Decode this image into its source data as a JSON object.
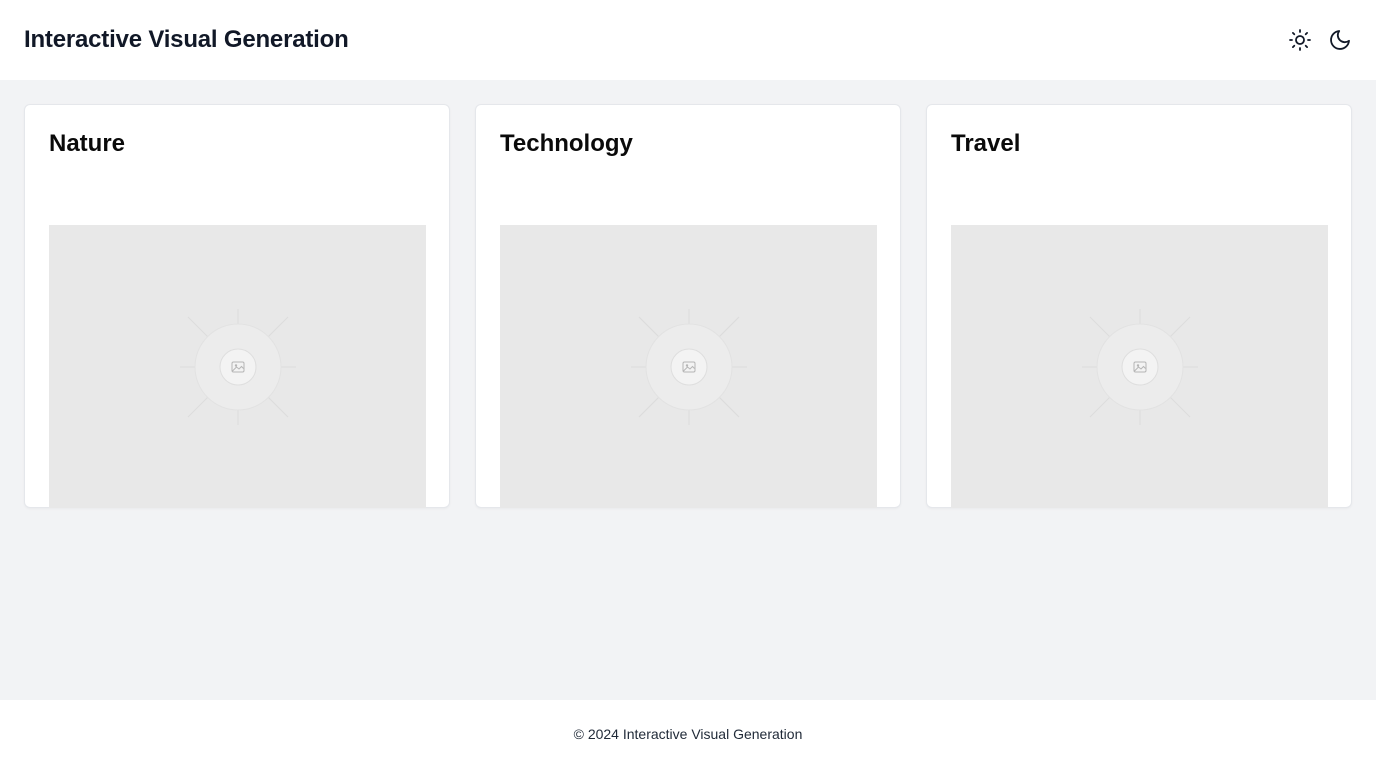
{
  "header": {
    "title": "Interactive Visual Generation",
    "light_icon": "sun-icon",
    "dark_icon": "moon-icon"
  },
  "cards": [
    {
      "title": "Nature",
      "image_icon": "image-placeholder-icon"
    },
    {
      "title": "Technology",
      "image_icon": "image-placeholder-icon"
    },
    {
      "title": "Travel",
      "image_icon": "image-placeholder-icon"
    }
  ],
  "footer": {
    "text": "© 2024 Interactive Visual Generation"
  },
  "colors": {
    "page_background": "#f2f3f5",
    "surface": "#ffffff",
    "placeholder": "#e8e8e8",
    "text": "#111827"
  }
}
